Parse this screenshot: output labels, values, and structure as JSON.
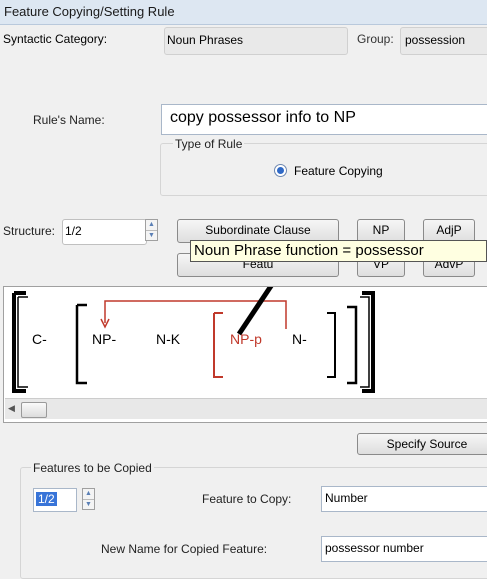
{
  "window": {
    "title": "Feature Copying/Setting Rule"
  },
  "header": {
    "category_label": "Syntactic Category:",
    "category_value": "Noun Phrases",
    "group_label": "Group:",
    "group_value": "possession"
  },
  "rule": {
    "name_label": "Rule's Name:",
    "name_value": "copy possessor info to NP",
    "type_label": "Type of Rule",
    "type_option": "Feature Copying"
  },
  "structure": {
    "label": "Structure:",
    "value": "1/2",
    "buttons": [
      "Subordinate Clause",
      "NP",
      "AdjP",
      "Featu",
      "VP",
      "AdvP"
    ]
  },
  "tooltip": "Noun Phrase function = possessor",
  "diagram": {
    "outer": "C-",
    "inner": [
      "NP-",
      "N-K"
    ],
    "highlighted": [
      "NP-p",
      "N-"
    ]
  },
  "source": {
    "button": "Specify Source"
  },
  "copy_group": {
    "label": "Features to be Copied",
    "index": "1/2",
    "feature_label": "Feature to Copy:",
    "feature_value": "Number",
    "newname_label": "New Name for Copied Feature:",
    "newname_value": "possessor number"
  },
  "colors": {
    "accent": "#c0392b",
    "highlight": "#3874d8"
  }
}
